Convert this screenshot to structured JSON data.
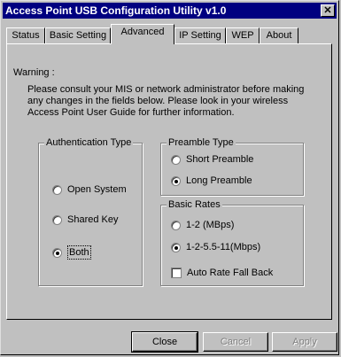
{
  "window": {
    "title": "Access Point USB Configuration Utility v1.0",
    "close_symbol": "✕"
  },
  "tabs": [
    "Status",
    "Basic Setting",
    "Advanced",
    "IP Setting",
    "WEP",
    "About"
  ],
  "warning": {
    "title": "Warning :",
    "body": "Please consult your MIS or network administrator before making any changes in the fields below. Please look in your wireless Access Point User Guide for further information."
  },
  "auth": {
    "label": "Authentication Type",
    "options": [
      "Open System",
      "Shared Key",
      "Both"
    ],
    "selected": "Both"
  },
  "preamble": {
    "label": "Preamble Type",
    "options": [
      "Short Preamble",
      "Long Preamble"
    ],
    "selected": "Long Preamble"
  },
  "rates": {
    "label": "Basic Rates",
    "options": [
      "1-2 (MBps)",
      "1-2-5.5-11(Mbps)"
    ],
    "selected": "1-2-5.5-11(Mbps)",
    "fallback_label": "Auto Rate Fall Back",
    "fallback_checked": false
  },
  "buttons": {
    "close": "Close",
    "cancel": "Cancel",
    "apply": "Apply"
  }
}
